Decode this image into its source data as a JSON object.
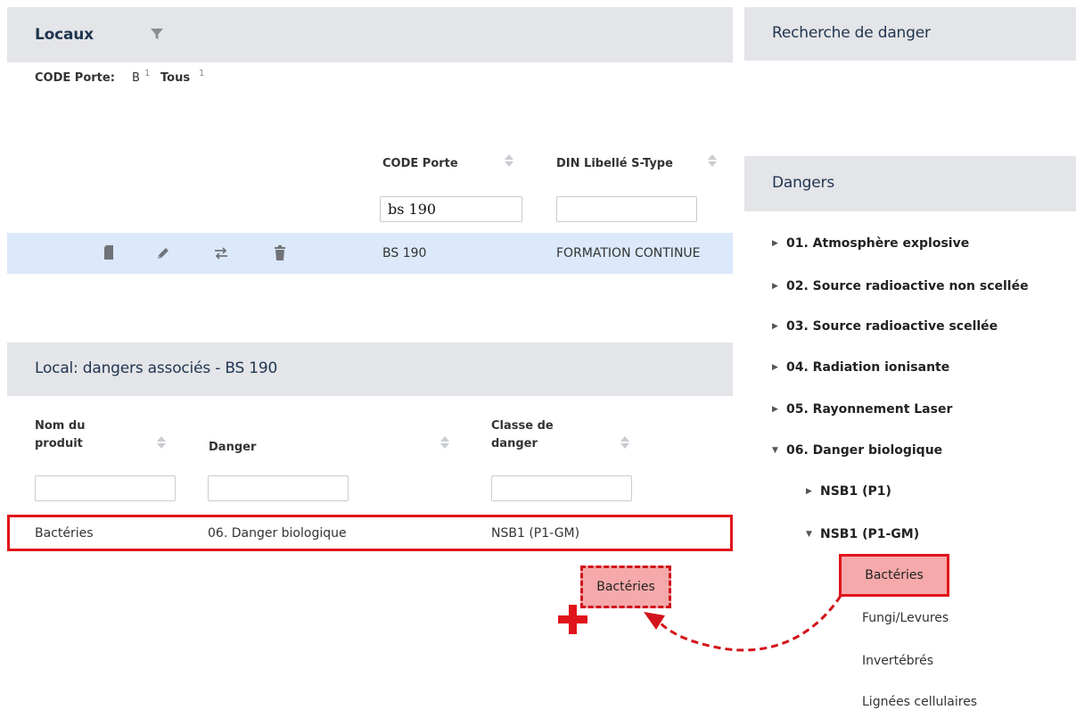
{
  "locaux": {
    "title": "Locaux",
    "filter_label": "CODE Porte:",
    "filter_value": "B",
    "filter_count": "1",
    "filter_all": "Tous",
    "filter_all_count": "1",
    "columns": [
      "CODE Porte",
      "DIN Libellé S-Type"
    ],
    "filters": {
      "code_porte": "bs 190",
      "din": ""
    },
    "row": {
      "code": "BS 190",
      "din": "FORMATION CONTINUE"
    }
  },
  "dangers_assoc": {
    "title": "Local: dangers associés - BS 190",
    "columns": {
      "nom_line1": "Nom du",
      "nom_line2": "produit",
      "danger": "Danger",
      "classe_line1": "Classe de",
      "classe_line2": "danger"
    },
    "row": {
      "nom": "Bactéries",
      "danger": "06. Danger biologique",
      "classe": "NSB1 (P1-GM)"
    }
  },
  "recherche": {
    "title": "Recherche de danger"
  },
  "dangers_tree": {
    "title": "Dangers",
    "items": [
      "01. Atmosphère explosive",
      "02. Source radioactive non scellée",
      "03. Source radioactive scellée",
      "04. Radiation ionisante",
      "05. Rayonnement Laser",
      "06. Danger biologique"
    ],
    "sub_items": [
      "NSB1 (P1)",
      "NSB1 (P1-GM)"
    ],
    "leaves": [
      "Bactéries",
      "Fungi/Levures",
      "Invertébrés",
      "Lignées cellulaires"
    ]
  },
  "drag": {
    "label": "Bactéries",
    "plus": "+"
  },
  "colors": {
    "accent_red": "#e0141b",
    "highlight_row": "#dbe9fa",
    "header_bg": "#e4e5e8",
    "title_color": "#1f3550"
  }
}
